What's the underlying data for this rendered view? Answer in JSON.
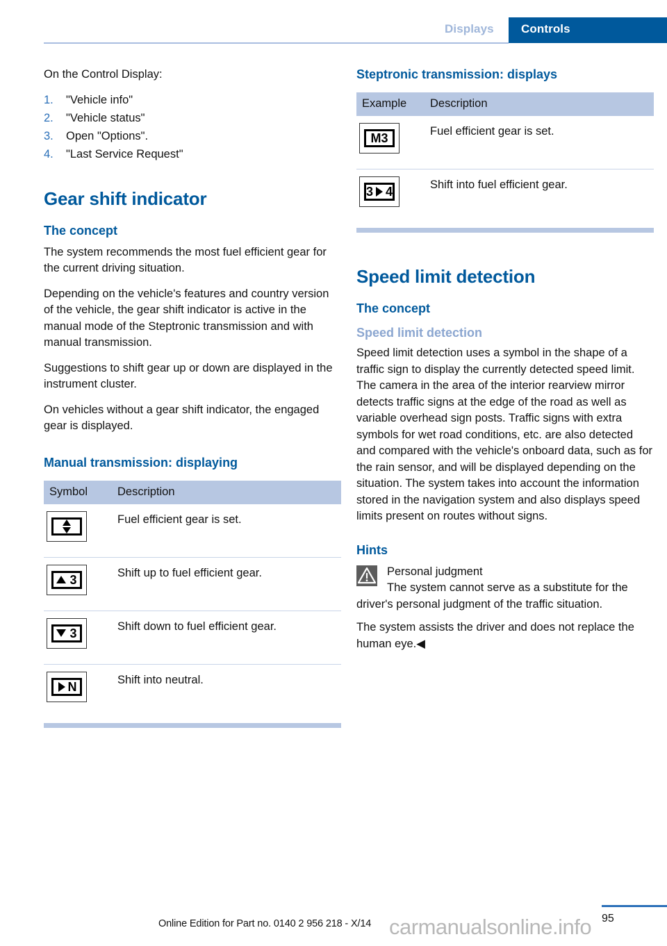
{
  "header": {
    "tab_inactive": "Displays",
    "tab_active": "Controls",
    "accent_blue": "#00599c",
    "tab_inactive_color": "#9fb6da"
  },
  "left_column": {
    "intro": "On the Control Display:",
    "steps": [
      {
        "num": "1.",
        "label": "\"Vehicle info\""
      },
      {
        "num": "2.",
        "label": "\"Vehicle status\""
      },
      {
        "num": "3.",
        "label": "Open \"Options\"."
      },
      {
        "num": "4.",
        "label": "\"Last Service Request\""
      }
    ],
    "section_title": "Gear shift indicator",
    "concept_heading": "The concept",
    "concept_paragraphs": [
      "The system recommends the most fuel efficient gear for the current driving situation.",
      "Depending on the vehicle's features and country version of the vehicle, the gear shift indicator is active in the manual mode of the Steptronic transmission and with manual transmission.",
      "Suggestions to shift gear up or down are displayed in the instrument cluster.",
      "On vehicles without a gear shift indicator, the engaged gear is displayed."
    ],
    "manual_heading": "Manual transmission: displaying",
    "manual_table": {
      "columns": [
        "Symbol",
        "Description"
      ],
      "rows": [
        {
          "icon": "updown-arrows-icon",
          "glyph": "updown",
          "text": "",
          "description": "Fuel efficient gear is set."
        },
        {
          "icon": "shift-up-gear-3-icon",
          "glyph": "up",
          "text": "3",
          "description": "Shift up to fuel efficient gear."
        },
        {
          "icon": "shift-down-gear-3-icon",
          "glyph": "down",
          "text": "3",
          "description": "Shift down to fuel efficient gear."
        },
        {
          "icon": "shift-neutral-icon",
          "glyph": "right",
          "text": "N",
          "description": "Shift into neutral."
        }
      ]
    }
  },
  "right_column": {
    "steptronic_heading": "Steptronic transmission: displays",
    "steptronic_table": {
      "columns": [
        "Example",
        "Description"
      ],
      "rows": [
        {
          "icon": "gear-m3-icon",
          "text": "M3",
          "description": "Fuel efficient gear is set."
        },
        {
          "icon": "gear-3-to-4-icon",
          "text_left": "3",
          "text_right": "4",
          "description": "Shift into fuel efficient gear."
        }
      ]
    },
    "speed_section_title": "Speed limit detection",
    "speed_concept_heading": "The concept",
    "speed_subheading": "Speed limit detection",
    "speed_paragraph": "Speed limit detection uses a symbol in the shape of a traffic sign to display the currently detected speed limit. The camera in the area of the interior rearview mirror detects traffic signs at the edge of the road as well as variable overhead sign posts. Traffic signs with extra symbols for wet road conditions, etc. are also detected and compared with the vehicle's onboard data, such as for the rain sensor, and will be displayed depending on the situation. The system takes into account the information stored in the navigation system and also displays speed limits present on routes without signs.",
    "hints_heading": "Hints",
    "hint_title": "Personal judgment",
    "hint_body": "The system cannot serve as a substitute for the driver's personal judgment of the traffic situation.",
    "hint_closing": "The system assists the driver and does not replace the human eye.◀"
  },
  "footer": {
    "note": "Online Edition for Part no. 0140 2 956 218 - X/14",
    "page_number": "95",
    "watermark": "carmanualsonline.info"
  }
}
